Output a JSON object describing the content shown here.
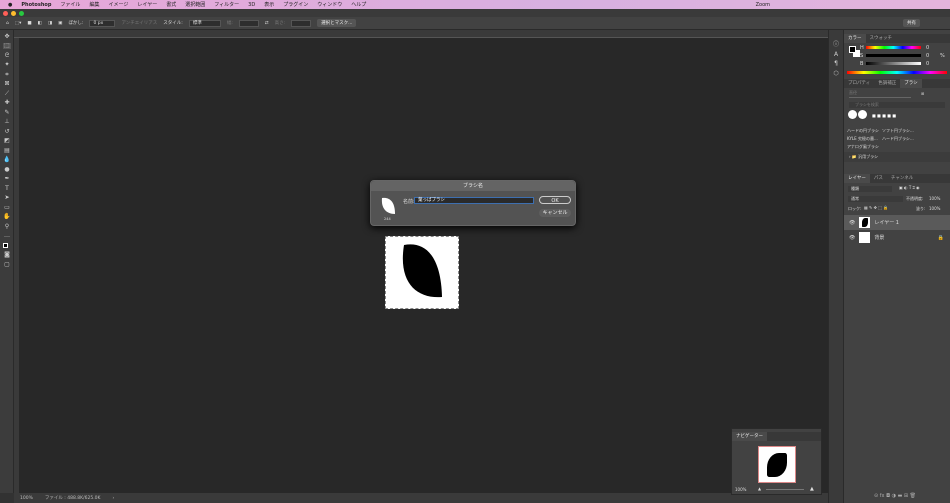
{
  "menubar": {
    "apple": "",
    "app": "Photoshop",
    "items": [
      "ファイル",
      "編集",
      "イメージ",
      "レイヤー",
      "書式",
      "選択範囲",
      "フィルター",
      "3D",
      "表示",
      "プラグイン",
      "ウィンドウ",
      "ヘルプ"
    ],
    "zoom_label": "Zoom"
  },
  "options": {
    "feather_label": "ぼかし:",
    "feather_value": "0 px",
    "antialias": "アンチエイリアス",
    "style_label": "スタイル:",
    "style_value": "標準",
    "width_label": "幅:",
    "height_label": "高さ:",
    "select_mask": "選択とマスク...",
    "share": "共有"
  },
  "dialog": {
    "title": "ブラシ名",
    "name_label": "名前:",
    "name_value": "葉っぱブラシ",
    "brush_size": "244",
    "ok": "OK",
    "cancel": "キャンセル"
  },
  "color_panel": {
    "tabs": [
      "カラー",
      "スウォッチ"
    ],
    "h": "H",
    "s": "S",
    "b": "B",
    "h_val": "0",
    "s_val": "0",
    "b_val": "0",
    "pct": "%"
  },
  "brush_panel": {
    "tabs": [
      "プロパティ",
      "色調補正",
      "ブラシ"
    ],
    "size_label": "直径",
    "search_placeholder": "ブラシを検索",
    "brushes": [
      "ハードの円ブラシ",
      "ソフト円ブラシ...",
      "KYLE 究極の墨...",
      "ハード円ブラシ...",
      "アナログ風ブラシ"
    ],
    "group": "汎用ブラシ"
  },
  "layers_panel": {
    "tabs": [
      "レイヤー",
      "パス",
      "チャンネル"
    ],
    "filter": "種類",
    "blend": "通常",
    "opacity_label": "不透明度:",
    "opacity": "100%",
    "lock_label": "ロック:",
    "fill_label": "塗り:",
    "fill": "100%",
    "layers": [
      "レイヤー 1",
      "背景"
    ]
  },
  "navigator": {
    "title": "ナビゲーター",
    "zoom": "100%"
  },
  "status": {
    "zoom": "100%",
    "file": "ファイル : 488.8K/625.0K"
  }
}
